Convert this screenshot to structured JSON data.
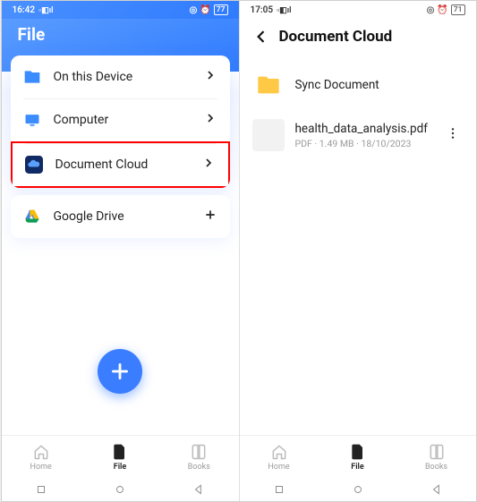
{
  "left": {
    "status": {
      "time": "16:42",
      "battery": "77"
    },
    "header": {
      "title": "File"
    },
    "items": [
      {
        "label": "On this Device",
        "action": "chevron"
      },
      {
        "label": "Computer",
        "action": "chevron"
      },
      {
        "label": "Document Cloud",
        "action": "chevron",
        "highlighted": true
      },
      {
        "label": "Google Drive",
        "action": "plus"
      }
    ],
    "nav": [
      {
        "label": "Home",
        "active": false
      },
      {
        "label": "File",
        "active": true
      },
      {
        "label": "Books",
        "active": false
      }
    ]
  },
  "right": {
    "status": {
      "time": "17:05",
      "battery": "71"
    },
    "header": {
      "title": "Document Cloud"
    },
    "entries": {
      "folder": {
        "label": "Sync Document"
      },
      "file": {
        "name": "health_data_analysis.pdf",
        "meta": "PDF · 1.49 MB · 18/10/2023"
      }
    },
    "nav": [
      {
        "label": "Home",
        "active": false
      },
      {
        "label": "File",
        "active": true
      },
      {
        "label": "Books",
        "active": false
      }
    ]
  }
}
